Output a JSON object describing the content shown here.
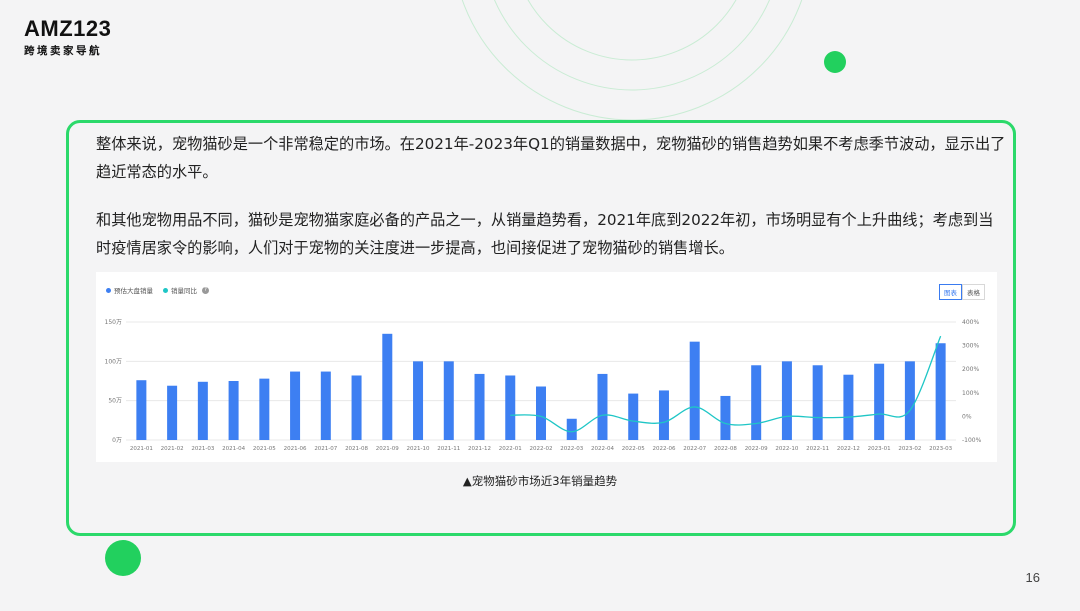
{
  "brand": {
    "logo_text": "AMZ123",
    "logo_sub": "跨境卖家导航"
  },
  "colors": {
    "accent_green": "#2bd96a",
    "bar_blue": "#3d7ff2",
    "line_cyan": "#1fc6c6"
  },
  "paragraphs": [
    "整体来说，宠物猫砂是一个非常稳定的市场。在2021年-2023年Q1的销量数据中，宠物猫砂的销售趋势如果不考虑季节波动，显示出了趋近常态的水平。",
    "和其他宠物用品不同，猫砂是宠物猫家庭必备的产品之一，从销量趋势看，2021年底到2022年初，市场明显有个上升曲线；考虑到当时疫情居家令的影响，人们对于宠物的关注度进一步提高，也间接促进了宠物猫砂的销售增长。"
  ],
  "chart_controls": {
    "view_chart": "图表",
    "view_table": "表格",
    "help_icon": "question-icon"
  },
  "chart_data": {
    "type": "bar",
    "categories": [
      "2021-01",
      "2021-02",
      "2021-03",
      "2021-04",
      "2021-05",
      "2021-06",
      "2021-07",
      "2021-08",
      "2021-09",
      "2021-10",
      "2021-11",
      "2021-12",
      "2022-01",
      "2022-02",
      "2022-03",
      "2022-04",
      "2022-05",
      "2022-06",
      "2022-07",
      "2022-08",
      "2022-09",
      "2022-10",
      "2022-11",
      "2022-12",
      "2023-01",
      "2023-02",
      "2023-03"
    ],
    "series": [
      {
        "name": "预估大盘销量",
        "type": "bar",
        "axis": "left",
        "values": [
          76,
          69,
          74,
          75,
          78,
          87,
          87,
          82,
          135,
          100,
          100,
          84,
          82,
          68,
          27,
          84,
          59,
          63,
          125,
          56,
          95,
          100,
          95,
          83,
          97,
          100,
          123
        ]
      },
      {
        "name": "销量同比",
        "type": "line",
        "axis": "right",
        "values": [
          null,
          null,
          null,
          null,
          null,
          null,
          null,
          null,
          null,
          null,
          null,
          null,
          5,
          0,
          -65,
          5,
          -20,
          -25,
          40,
          -30,
          -30,
          0,
          -5,
          -3,
          10,
          25,
          340
        ]
      }
    ],
    "y_left": {
      "ylim": [
        0,
        150
      ],
      "ticks": [
        0,
        50,
        100,
        150
      ],
      "tick_labels": [
        "0万",
        "50万",
        "100万",
        "150万"
      ]
    },
    "y_right": {
      "ylim": [
        -100,
        400
      ],
      "ticks": [
        -100,
        0,
        100,
        200,
        300,
        400
      ],
      "tick_labels": [
        "-100%",
        "0%",
        "100%",
        "200%",
        "300%",
        "400%"
      ]
    },
    "grid": true,
    "legend": "top-left"
  },
  "caption": "▲宠物猫砂市场近3年销量趋势",
  "page_number": "16"
}
